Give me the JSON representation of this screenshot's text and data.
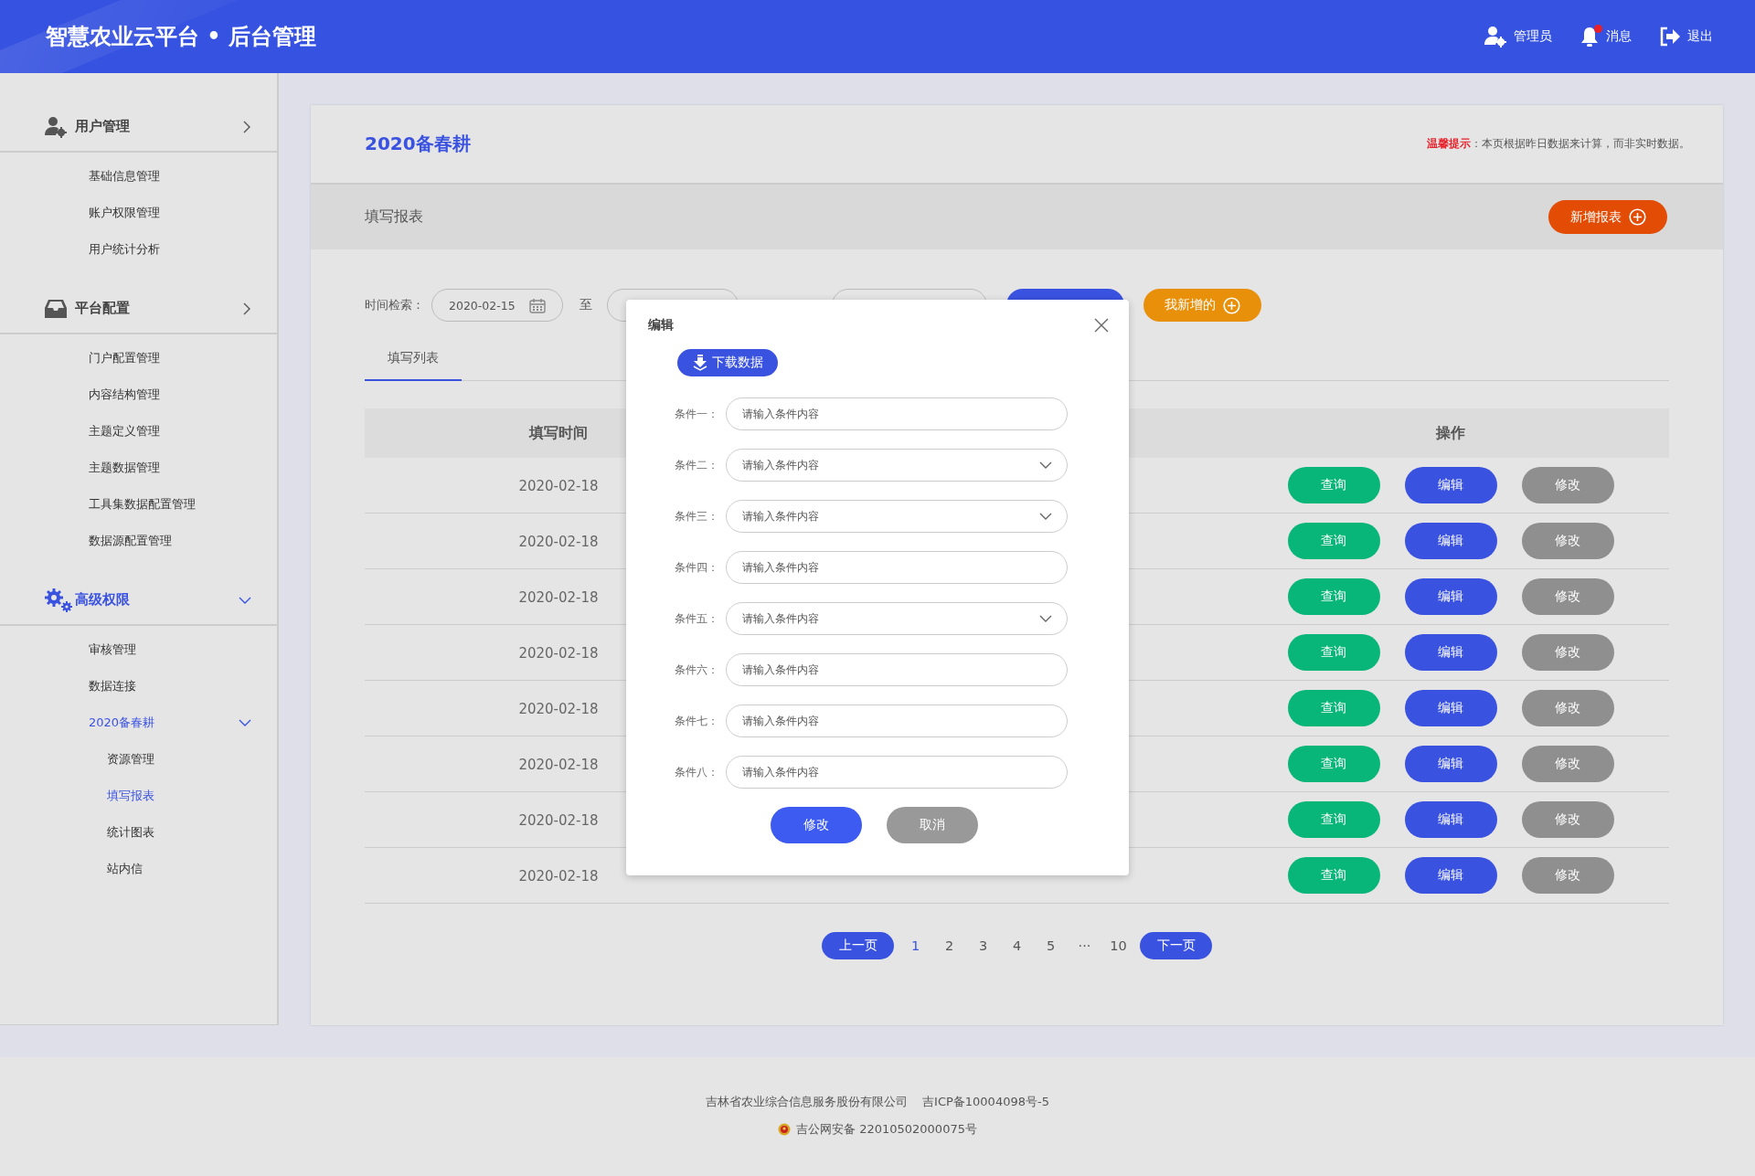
{
  "header": {
    "title": "智慧农业云平台 • 后台管理",
    "actions": [
      {
        "kind": "user",
        "label": "管理员"
      },
      {
        "kind": "bell",
        "label": "消息",
        "unread": true
      },
      {
        "kind": "logout",
        "label": "退出"
      }
    ]
  },
  "sidebar": {
    "groups": [
      {
        "kind": "user",
        "label": "用户管理",
        "expanded": false,
        "selected": false,
        "items": [
          {
            "label": "基础信息管理",
            "selected": false
          },
          {
            "label": "账户权限管理",
            "selected": false
          },
          {
            "label": "用户统计分析",
            "selected": false
          }
        ]
      },
      {
        "kind": "tray",
        "label": "平台配置",
        "expanded": false,
        "selected": false,
        "items": [
          {
            "label": "门户配置管理",
            "selected": false
          },
          {
            "label": "内容结构管理",
            "selected": false
          },
          {
            "label": "主题定义管理",
            "selected": false
          },
          {
            "label": "主题数据管理",
            "selected": false
          },
          {
            "label": "工具集数据配置管理",
            "selected": false
          },
          {
            "label": "数据源配置管理",
            "selected": false
          }
        ]
      },
      {
        "kind": "gears",
        "label": "高级权限",
        "expanded": true,
        "selected": true,
        "items": [
          {
            "label": "审核管理",
            "selected": false
          },
          {
            "label": "数据连接",
            "selected": false
          },
          {
            "label": "2020备春耕",
            "selected": true,
            "expanded": true,
            "children": [
              {
                "label": "资源管理",
                "selected": false
              },
              {
                "label": "填写报表",
                "selected": true
              },
              {
                "label": "统计图表",
                "selected": false
              },
              {
                "label": "站内信",
                "selected": false
              }
            ]
          }
        ]
      }
    ]
  },
  "page": {
    "title": "2020备春耕",
    "notice": {
      "label": "温馨提示",
      "text": "：本页根据昨日数据来计算，而非实时数据。"
    },
    "section": "填写报表",
    "add_button": "新增报表",
    "filter": {
      "label": "时间检索：",
      "start": "2020-02-15",
      "separator": "至",
      "mine_button": "我新增的"
    },
    "tabs": [
      {
        "label": "填写列表",
        "selected": true
      }
    ],
    "table": {
      "columns": [
        "填写时间",
        "操作"
      ],
      "rows": [
        {
          "date": "2020-02-18",
          "actions": [
            "查询",
            "编辑",
            "修改"
          ]
        },
        {
          "date": "2020-02-18",
          "actions": [
            "查询",
            "编辑",
            "修改"
          ]
        },
        {
          "date": "2020-02-18",
          "actions": [
            "查询",
            "编辑",
            "修改"
          ]
        },
        {
          "date": "2020-02-18",
          "actions": [
            "查询",
            "编辑",
            "修改"
          ]
        },
        {
          "date": "2020-02-18",
          "actions": [
            "查询",
            "编辑",
            "修改"
          ]
        },
        {
          "date": "2020-02-18",
          "actions": [
            "查询",
            "编辑",
            "修改"
          ]
        },
        {
          "date": "2020-02-18",
          "actions": [
            "查询",
            "编辑",
            "修改"
          ]
        },
        {
          "date": "2020-02-18",
          "actions": [
            "查询",
            "编辑",
            "修改"
          ]
        }
      ]
    },
    "pagination": {
      "prev": "上一页",
      "next": "下一页",
      "pages": [
        {
          "label": "1",
          "selected": true
        },
        {
          "label": "2",
          "selected": false
        },
        {
          "label": "3",
          "selected": false
        },
        {
          "label": "4",
          "selected": false
        },
        {
          "label": "5",
          "selected": false
        },
        {
          "label": "···",
          "selected": false
        },
        {
          "label": "10",
          "selected": false
        }
      ]
    }
  },
  "dialog": {
    "title": "编辑",
    "download_button": "下载数据",
    "fields": [
      {
        "kind": "text",
        "label": "条件一：",
        "placeholder": "请输入条件内容"
      },
      {
        "kind": "select",
        "label": "条件二：",
        "placeholder": "请输入条件内容"
      },
      {
        "kind": "select",
        "label": "条件三：",
        "placeholder": "请输入条件内容"
      },
      {
        "kind": "text",
        "label": "条件四：",
        "placeholder": "请输入条件内容"
      },
      {
        "kind": "select",
        "label": "条件五：",
        "placeholder": "请输入条件内容"
      },
      {
        "kind": "text",
        "label": "条件六：",
        "placeholder": "请输入条件内容"
      },
      {
        "kind": "text",
        "label": "条件七：",
        "placeholder": "请输入条件内容"
      },
      {
        "kind": "text",
        "label": "条件八：",
        "placeholder": "请输入条件内容"
      }
    ],
    "confirm": "修改",
    "cancel": "取消"
  },
  "footer": {
    "company": "吉林省农业综合信息服务股份有限公司",
    "icp": "吉ICP备10004098号-5",
    "police": "吉公网安备 22010502000075号"
  }
}
